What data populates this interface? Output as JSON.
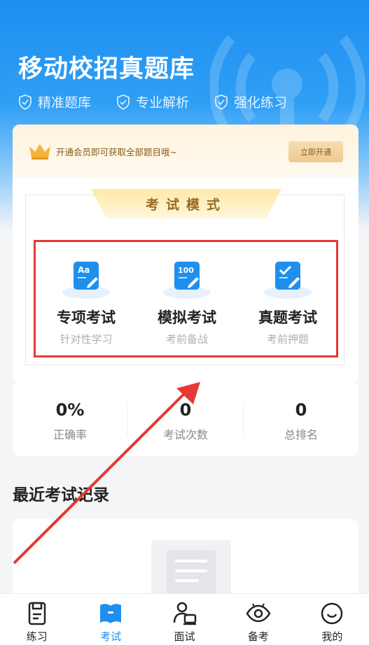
{
  "header": {
    "title": "移动校招真题库",
    "features": [
      "精准题库",
      "专业解析",
      "强化练习"
    ]
  },
  "vip": {
    "text": "开通会员即可获取全部题目哦~",
    "button": "立即开通"
  },
  "exam_mode": {
    "title": "考试模式",
    "modes": [
      {
        "name": "专项考试",
        "desc": "针对性学习",
        "icon": "aa-icon"
      },
      {
        "name": "模拟考试",
        "desc": "考前备战",
        "icon": "score-100-icon"
      },
      {
        "name": "真题考试",
        "desc": "考前押题",
        "icon": "check-icon"
      }
    ]
  },
  "stats": [
    {
      "value": "0%",
      "label": "正确率"
    },
    {
      "value": "0",
      "label": "考试次数"
    },
    {
      "value": "0",
      "label": "总排名"
    }
  ],
  "records": {
    "title": "最近考试记录"
  },
  "tabbar": {
    "items": [
      {
        "label": "练习",
        "icon": "practice-icon"
      },
      {
        "label": "考试",
        "icon": "exam-book-icon"
      },
      {
        "label": "面试",
        "icon": "interview-icon"
      },
      {
        "label": "备考",
        "icon": "eye-icon"
      },
      {
        "label": "我的",
        "icon": "smile-icon"
      }
    ],
    "active_index": 1
  },
  "colors": {
    "primary": "#1f8fee",
    "highlight_border": "#e53935",
    "vip_text": "#8a5a1c"
  }
}
